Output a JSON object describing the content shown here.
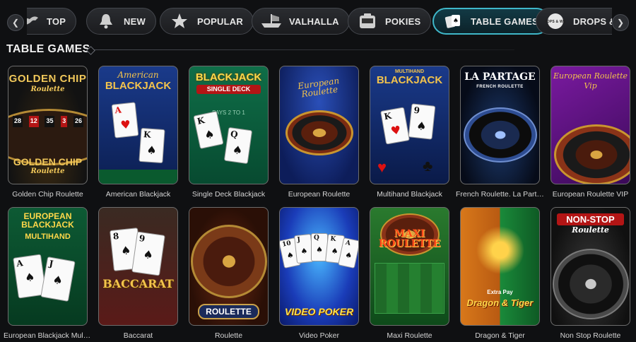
{
  "nav": {
    "tabs": [
      {
        "label": "TOP",
        "icon": "dragon-icon",
        "active": false
      },
      {
        "label": "NEW",
        "icon": "bell-icon",
        "active": false
      },
      {
        "label": "POPULAR",
        "icon": "star-icon",
        "active": false
      },
      {
        "label": "VALHALLA",
        "icon": "viking-ship-icon",
        "active": false
      },
      {
        "label": "POKIES",
        "icon": "slot-machine-icon",
        "active": false
      },
      {
        "label": "TABLE GAMES",
        "icon": "cards-icon",
        "active": true
      },
      {
        "label": "DROPS & WINS",
        "icon": "drops-wins-icon",
        "active": false,
        "icon_text": "DROPS & WINS"
      }
    ]
  },
  "section": {
    "title": "TABLE GAMES"
  },
  "games": [
    {
      "name": "Golden Chip Roulette",
      "art_title": "GOLDEN CHIP",
      "art_subtitle": "Roulette",
      "art_numbers": [
        "28",
        "12",
        "35",
        "3",
        "26"
      ]
    },
    {
      "name": "American Blackjack",
      "art_title": "BLACKJACK",
      "art_subtitle": "American"
    },
    {
      "name": "Single Deck Blackjack",
      "art_title": "BLACKJACK",
      "art_subtitle": "SINGLE DECK",
      "art_text": "PAYS 2 TO 1"
    },
    {
      "name": "European Roulette",
      "art_title": "European Roulette"
    },
    {
      "name": "Multihand Blackjack",
      "art_title": "BLACKJACK",
      "art_subtitle": "MULTIHAND"
    },
    {
      "name": "French Roulette. La Partage",
      "art_title": "LA PARTAGE",
      "art_subtitle": "FRENCH ROULETTE"
    },
    {
      "name": "European Roulette VIP",
      "art_title": "European Roulette",
      "art_subtitle": "Vip"
    },
    {
      "name": "European Blackjack Multiha...",
      "art_title": "EUROPEAN BLACKJACK",
      "art_subtitle": "MULTIHAND"
    },
    {
      "name": "Baccarat",
      "art_title": "BACCARAT"
    },
    {
      "name": "Roulette",
      "art_title": "ROULETTE"
    },
    {
      "name": "Video Poker",
      "art_title": "VIDEO POKER",
      "art_cards": [
        "10",
        "J",
        "Q",
        "K",
        "A"
      ]
    },
    {
      "name": "Maxi Roulette",
      "art_title": "MAXI ROULETTE"
    },
    {
      "name": "Dragon & Tiger",
      "art_title": "Dragon & Tiger",
      "art_subtitle": "Extra Pay"
    },
    {
      "name": "Non Stop Roulette",
      "art_title": "NON-STOP",
      "art_subtitle": "Roulette"
    }
  ]
}
